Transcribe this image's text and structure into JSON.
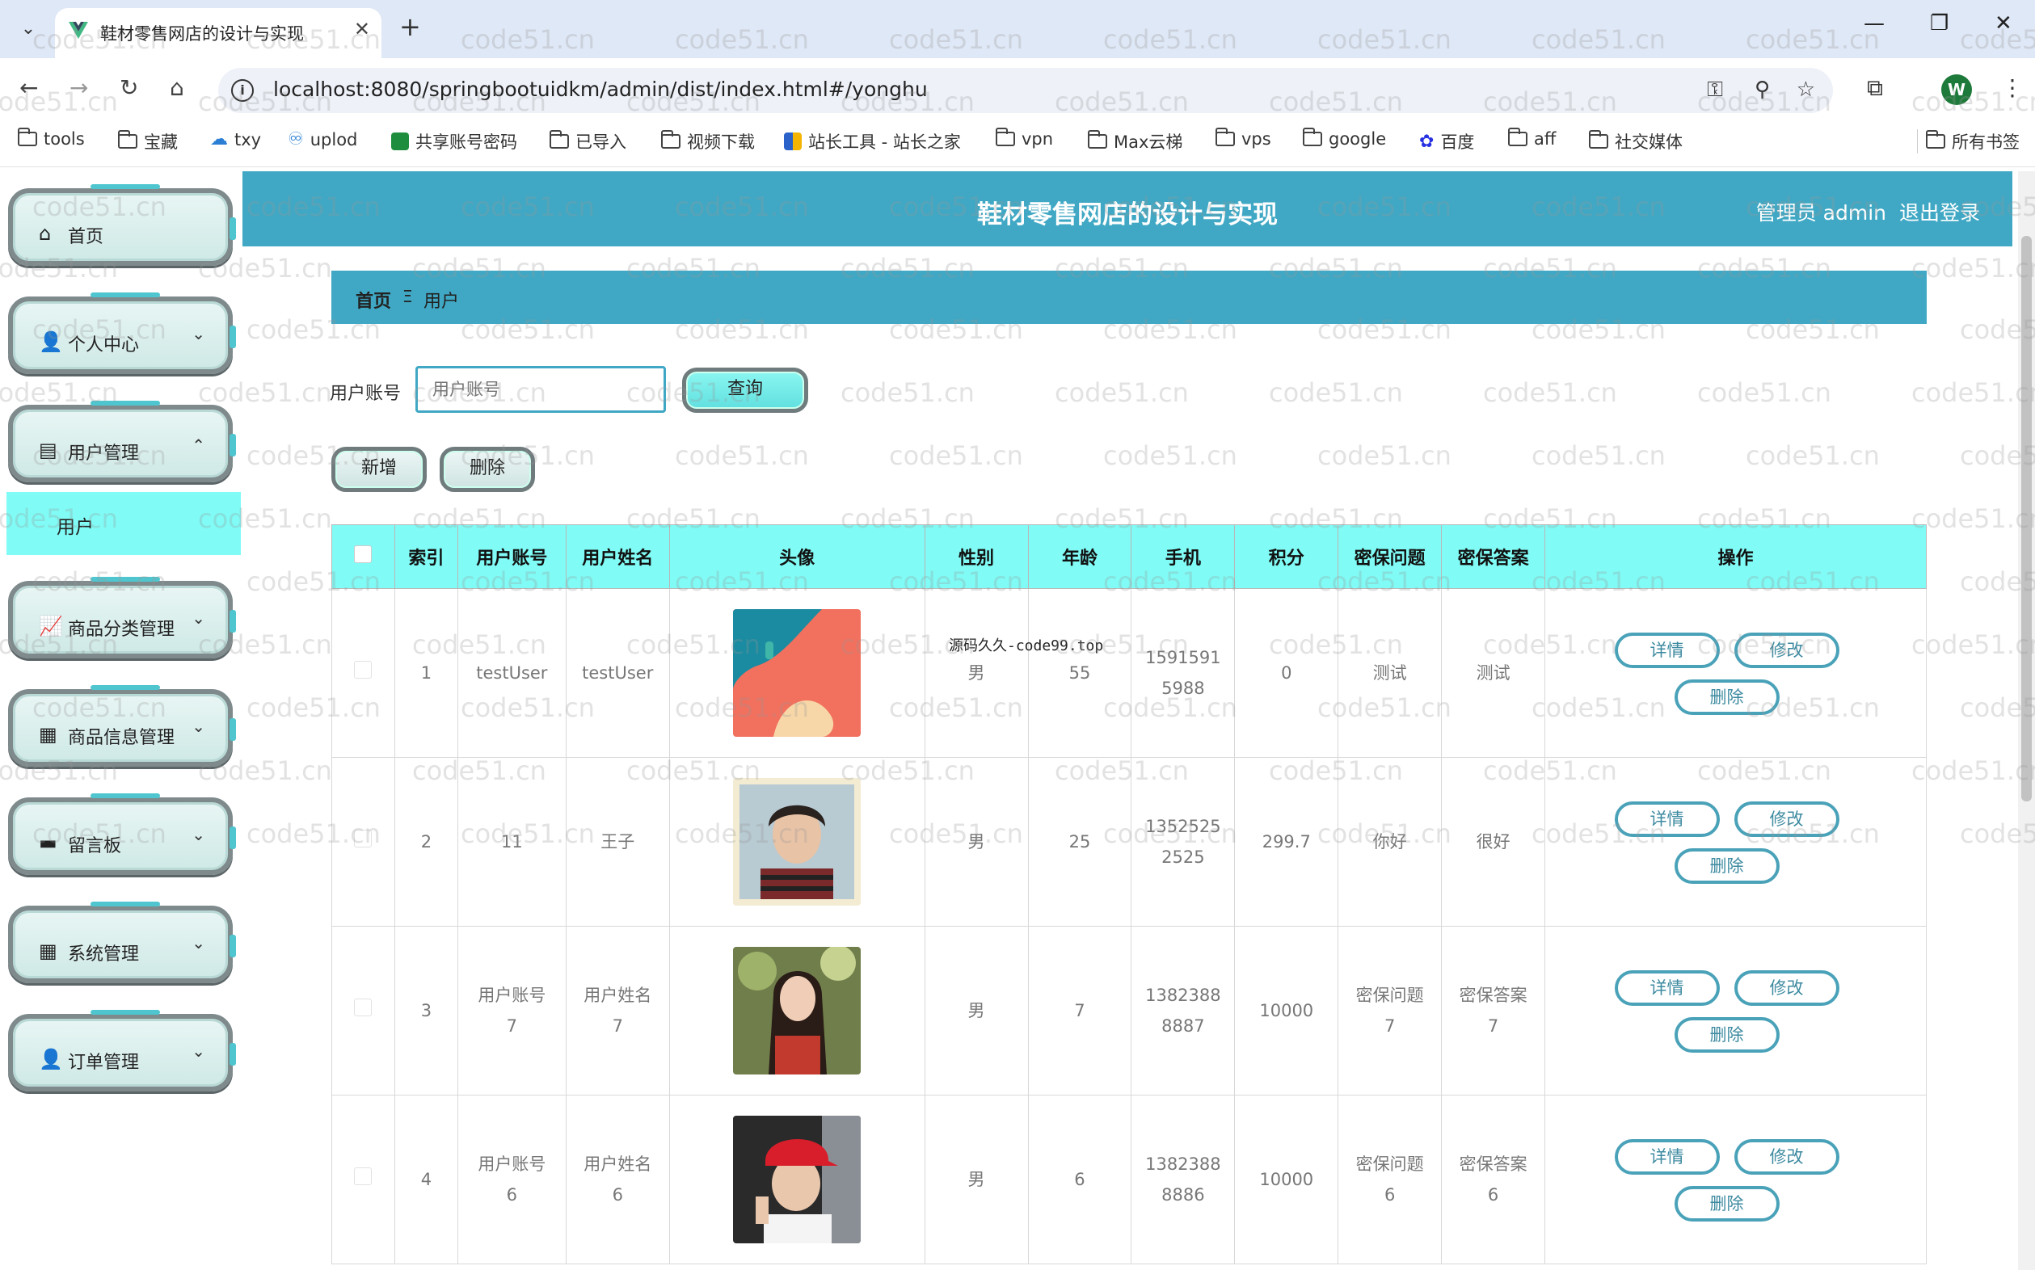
{
  "browser": {
    "tab_title": "鞋材零售网店的设计与实现",
    "url": "localhost:8080/springbootuidkm/admin/dist/index.html#/yonghu",
    "profile_initial": "W",
    "bookmarks": [
      "tools",
      "宝藏",
      "txy",
      "uplod",
      "共享账号密码",
      "已导入",
      "视频下载",
      "站长工具 - 站长之家",
      "vpn",
      "Max云梯",
      "vps",
      "google",
      "百度",
      "aff",
      "社交媒体"
    ],
    "all_bookmarks": "所有书签"
  },
  "header": {
    "site_title": "鞋材零售网店的设计与实现",
    "user_label": "管理员 admin",
    "logout": "退出登录"
  },
  "sidebar": {
    "items": [
      {
        "label": "首页",
        "icon": "home-icon"
      },
      {
        "label": "个人中心",
        "icon": "user-icon"
      },
      {
        "label": "用户管理",
        "icon": "chat-icon"
      },
      {
        "label": "商品分类管理",
        "icon": "chart-icon"
      },
      {
        "label": "商品信息管理",
        "icon": "grid-icon"
      },
      {
        "label": "留言板",
        "icon": "monitor-icon"
      },
      {
        "label": "系统管理",
        "icon": "grid-icon"
      },
      {
        "label": "订单管理",
        "icon": "user-icon"
      }
    ],
    "submenu": "用户"
  },
  "breadcrumb": {
    "home": "首页",
    "sep": "Ξ",
    "current": "用户"
  },
  "search": {
    "label": "用户账号",
    "placeholder": "用户账号",
    "button": "查询"
  },
  "actions": {
    "add": "新增",
    "delete": "删除"
  },
  "table": {
    "headers": [
      "索引",
      "用户账号",
      "用户姓名",
      "头像",
      "性别",
      "年龄",
      "手机",
      "积分",
      "密保问题",
      "密保答案",
      "操作"
    ],
    "op_labels": {
      "detail": "详情",
      "edit": "修改",
      "delete": "删除"
    },
    "rows": [
      {
        "index": "1",
        "account": "testUser",
        "name": "testUser",
        "gender": "男",
        "age": "55",
        "phone": "15915915988",
        "points": "0",
        "question": "测试",
        "answer": "测试"
      },
      {
        "index": "2",
        "account": "11",
        "name": "王子",
        "gender": "男",
        "age": "25",
        "phone": "13525252525",
        "points": "299.7",
        "question": "你好",
        "answer": "很好"
      },
      {
        "index": "3",
        "account": "用户账号7",
        "name": "用户姓名7",
        "gender": "男",
        "age": "7",
        "phone": "13823888887",
        "points": "10000",
        "question": "密保问题7",
        "answer": "密保答案7"
      },
      {
        "index": "4",
        "account": "用户账号6",
        "name": "用户姓名6",
        "gender": "男",
        "age": "6",
        "phone": "13823888886",
        "points": "10000",
        "question": "密保问题6",
        "answer": "密保答案6"
      }
    ]
  },
  "overlay_note": "源码久久-code99.top",
  "watermark": "code51.cn"
}
